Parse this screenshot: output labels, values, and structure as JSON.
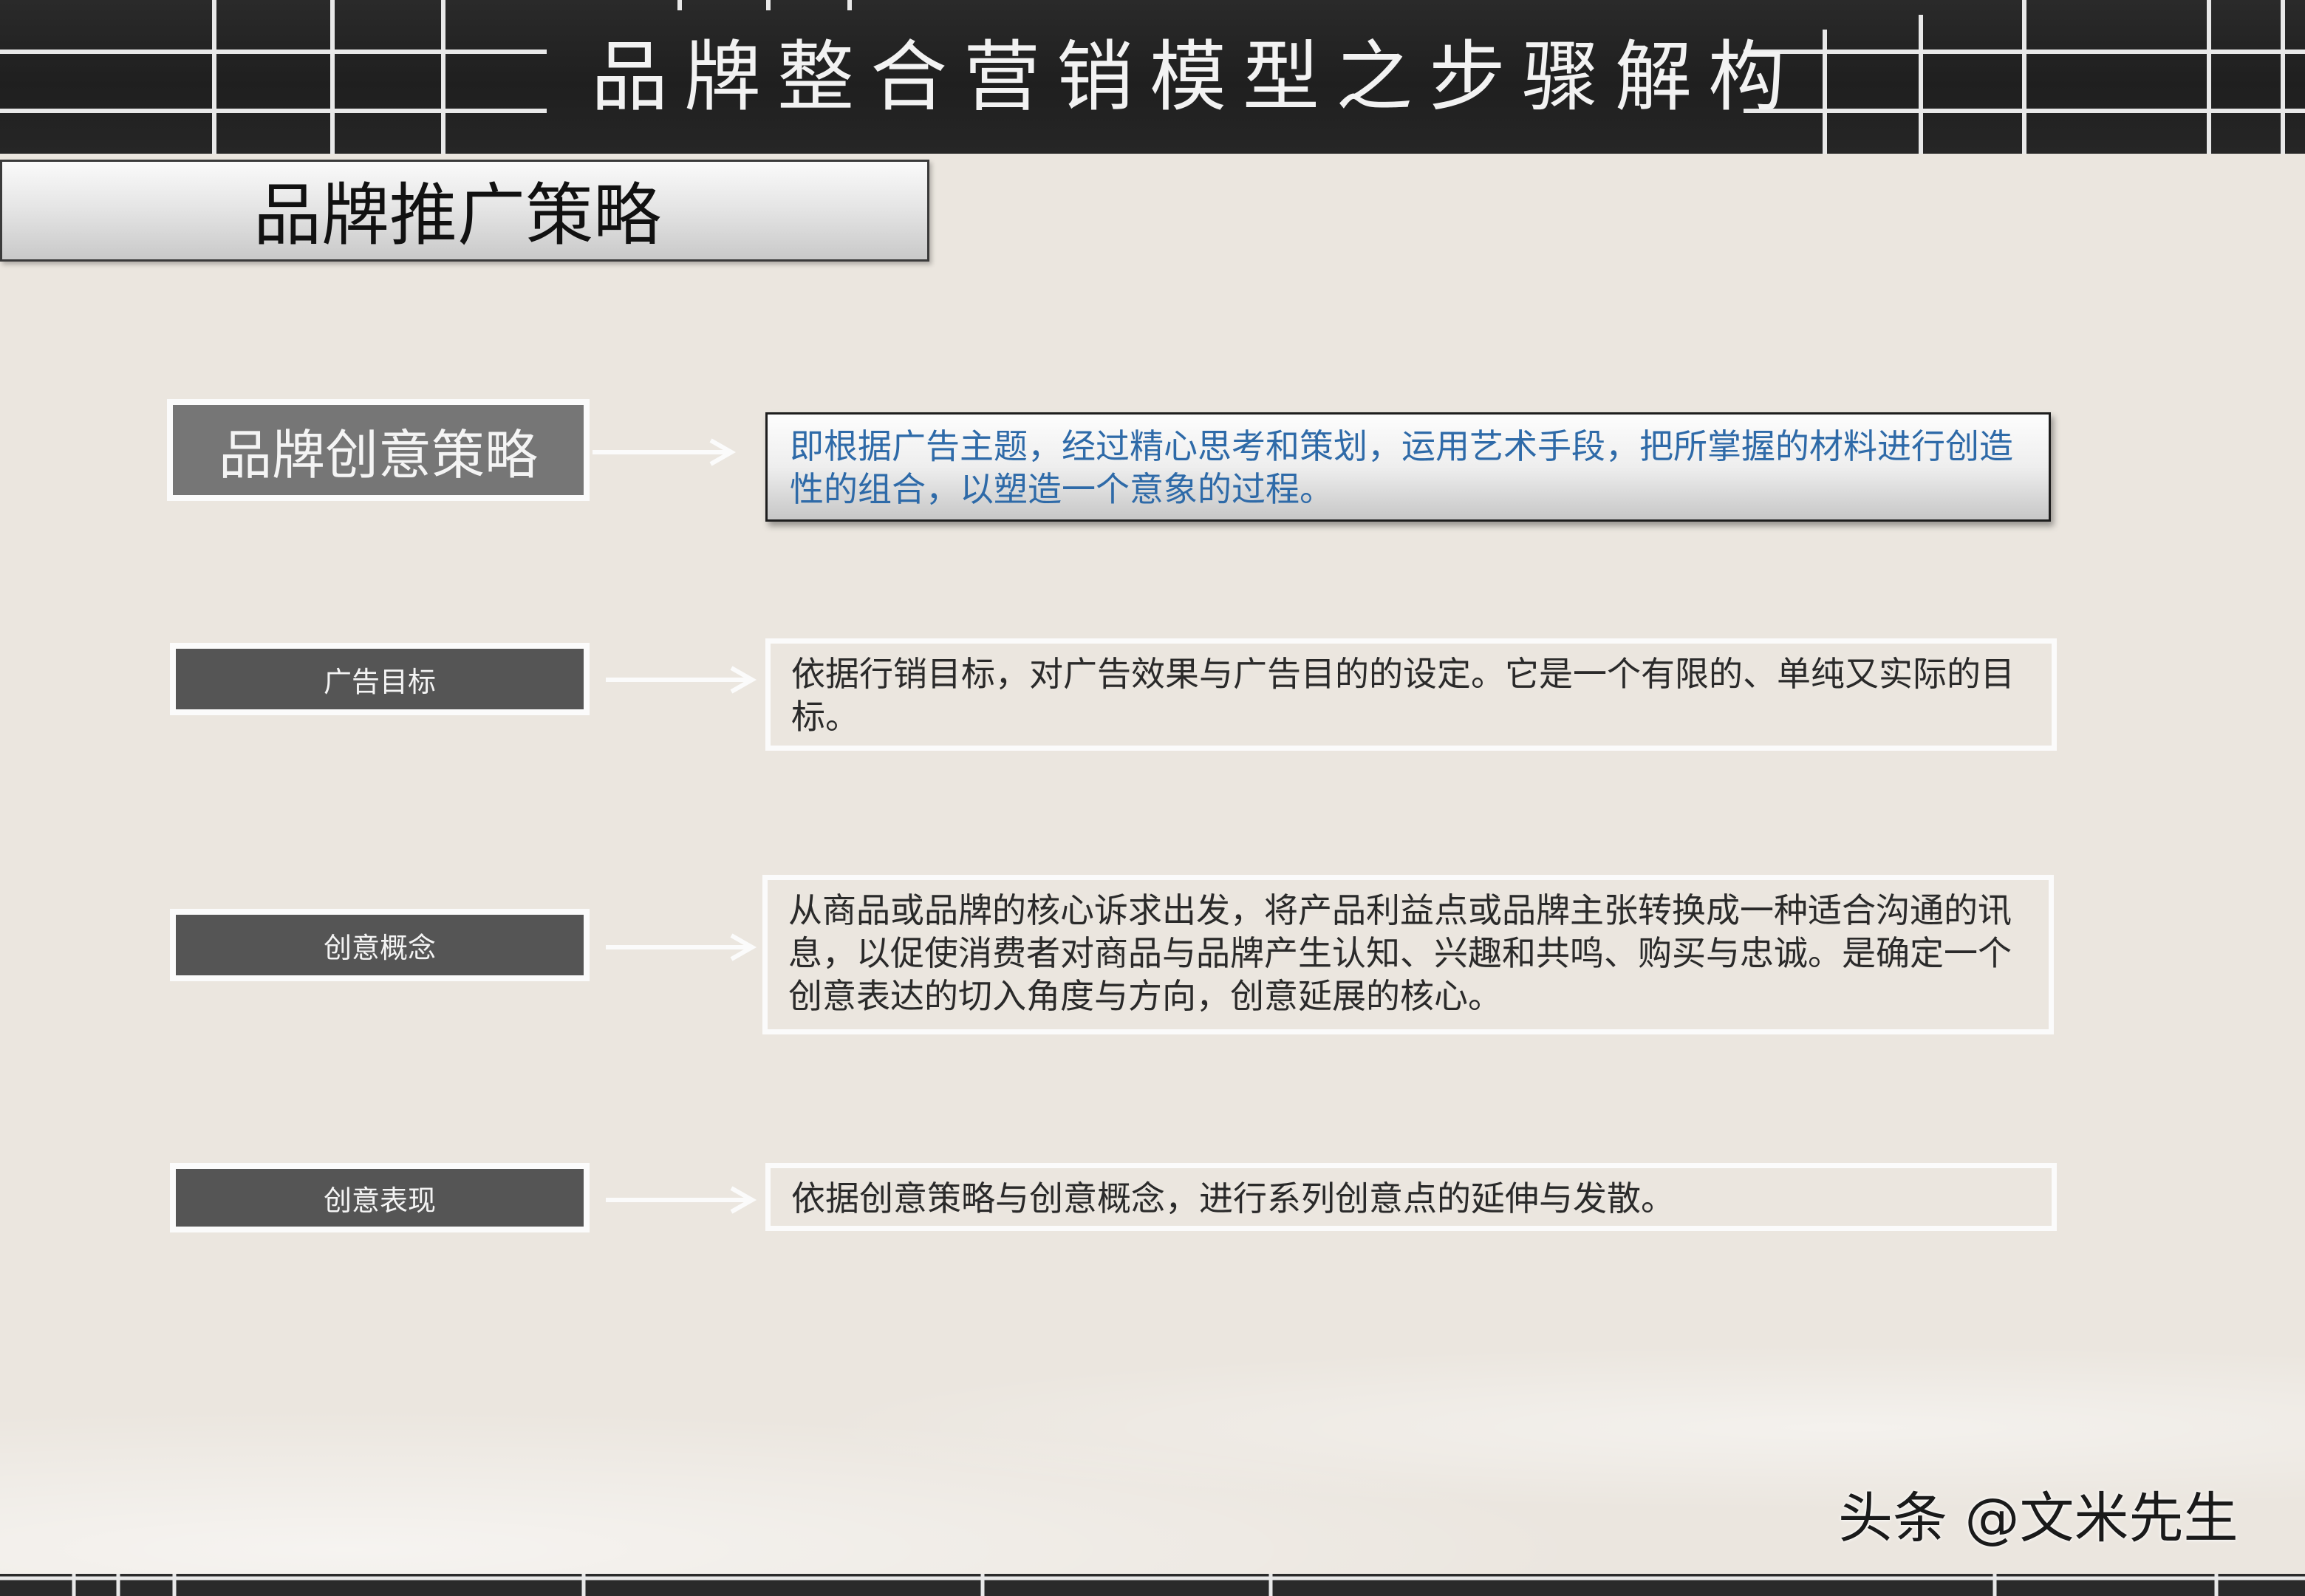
{
  "header": {
    "title": "品牌整合营销模型之步骤解构"
  },
  "section": {
    "title": "品牌推广策略"
  },
  "rows": [
    {
      "label": "品牌创意策略",
      "description": "即根据广告主题，经过精心思考和策划，运用艺术手段，把所掌握的材料进行创造性的组合，以塑造一个意象的过程。"
    },
    {
      "label": "广告目标",
      "description": "依据行销目标，对广告效果与广告目的的设定。它是一个有限的、单纯又实际的目标。"
    },
    {
      "label": "创意概念",
      "description": "从商品或品牌的核心诉求出发，将产品利益点或品牌主张转换成一种适合沟通的讯息，以促使消费者对商品与品牌产生认知、兴趣和共鸣、购买与忠诚。是确定一个创意表达的切入角度与方向，创意延展的核心。"
    },
    {
      "label": "创意表现",
      "description": "依据创意策略与创意概念，进行系列创意点的延伸与发散。"
    }
  ],
  "watermark": {
    "text": "头条 @文米先生"
  },
  "colors": {
    "banner": "#222222",
    "background": "#ebe6df",
    "highlight_text": "#2e6aa8",
    "label_dark": "#555555",
    "label_light": "#767676"
  }
}
